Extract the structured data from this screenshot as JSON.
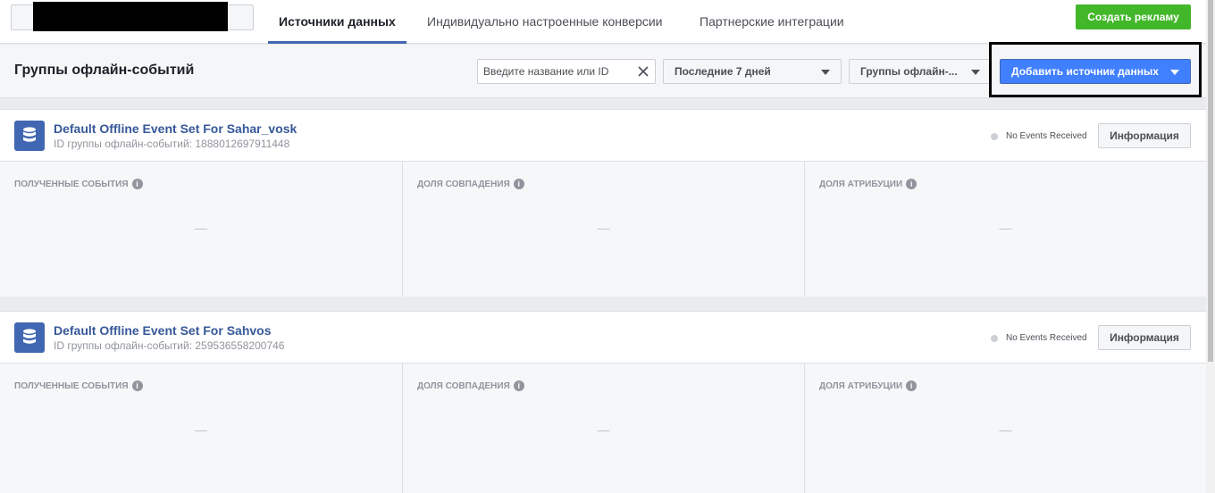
{
  "tabs": [
    {
      "label": "Источники данных",
      "active": true
    },
    {
      "label": "Индивидуально настроенные конверсии",
      "active": false
    },
    {
      "label": "Партнерские интеграции",
      "active": false
    }
  ],
  "create_ad_label": "Создать рекламу",
  "toolbar": {
    "title": "Группы офлайн-событий",
    "search_placeholder": "Введите название или ID",
    "date_range": "Последние 7 дней",
    "group_filter": "Группы офлайн-...",
    "add_source_label": "Добавить источник данных"
  },
  "event_sets": [
    {
      "name": "Default Offline Event Set For Sahar_vosk",
      "id_text": "ID группы офлайн-событий: 1888012697911448",
      "status": "No Events Received",
      "info_label": "Информация",
      "metrics": [
        {
          "label": "ПОЛУЧЕННЫЕ СОБЫТИЯ",
          "value": "—"
        },
        {
          "label": "ДОЛЯ СОВПАДЕНИЯ",
          "value": "—"
        },
        {
          "label": "ДОЛЯ АТРИБУЦИИ",
          "value": "—"
        }
      ]
    },
    {
      "name": "Default Offline Event Set For Sahvos",
      "id_text": "ID группы офлайн-событий: 259536558200746",
      "status": "No Events Received",
      "info_label": "Информация",
      "metrics": [
        {
          "label": "ПОЛУЧЕННЫЕ СОБЫТИЯ",
          "value": "—"
        },
        {
          "label": "ДОЛЯ СОВПАДЕНИЯ",
          "value": "—"
        },
        {
          "label": "ДОЛЯ АТРИБУЦИИ",
          "value": "—"
        }
      ]
    }
  ],
  "colors": {
    "accent": "#4267b2",
    "primary_button": "#4080ff",
    "create_button": "#42b72a",
    "link": "#365899"
  },
  "icons": [
    "close-icon",
    "chevron-down-icon",
    "database-icon",
    "help-icon"
  ]
}
